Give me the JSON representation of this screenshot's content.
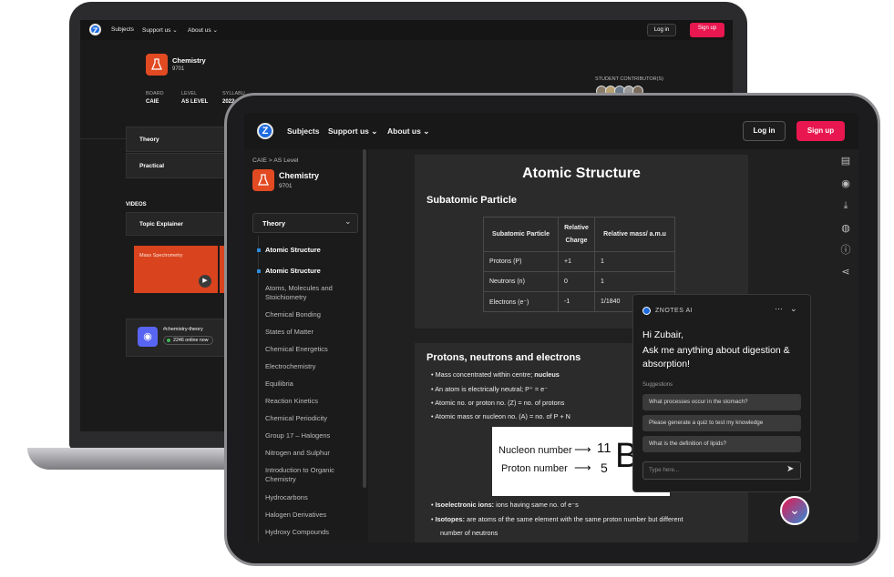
{
  "laptop": {
    "nav": {
      "logo_letter": "Z",
      "links": [
        "Subjects",
        "Support us ⌄",
        "About us ⌄"
      ],
      "login_label": "Log in",
      "signup_label": "Sign up"
    },
    "subject": {
      "name": "Chemistry",
      "code": "9701"
    },
    "meta": {
      "board_label": "BOARD",
      "board_value": "CAIE",
      "level_label": "LEVEL",
      "level_value": "AS LEVEL",
      "syllabus_label": "SYLLABU",
      "syllabus_value": "2022"
    },
    "contributors_label": "STUDENT CONTRIBUTOR(S)",
    "tabs": [
      "Theory",
      "Practical"
    ],
    "videos_label": "VIDEOS",
    "topic_explainer_label": "Topic Explainer",
    "video_title": "Mass Spectrometry",
    "discord": {
      "channel": "#chemistry-theory",
      "online": "2246 online now"
    }
  },
  "tablet": {
    "nav": {
      "logo_letter": "Z",
      "links": [
        "Subjects",
        "Support us ⌄",
        "About us ⌄"
      ],
      "login_label": "Log in",
      "signup_label": "Sign up"
    },
    "breadcrumb": "CAIE  >  AS Level",
    "subject": {
      "name": "Chemistry",
      "code": "9701"
    },
    "dropdown_label": "Theory",
    "sidebar_items": [
      {
        "label": "Atomic Structure",
        "active": true
      },
      {
        "label": "Atomic Structure",
        "active": true
      },
      {
        "label": "Atoms, Molecules and Stoichiometry",
        "active": false
      },
      {
        "label": "Chemical Bonding",
        "active": false
      },
      {
        "label": "States of Matter",
        "active": false
      },
      {
        "label": "Chemical Energetics",
        "active": false
      },
      {
        "label": "Electrochemistry",
        "active": false
      },
      {
        "label": "Equilibria",
        "active": false
      },
      {
        "label": "Reaction Kinetics",
        "active": false
      },
      {
        "label": "Chemical Periodicity",
        "active": false
      },
      {
        "label": "Group 17 – Halogens",
        "active": false
      },
      {
        "label": "Nitrogen and Sulphur",
        "active": false
      },
      {
        "label": "Introduction to Organic Chemistry",
        "active": false
      },
      {
        "label": "Hydrocarbons",
        "active": false
      },
      {
        "label": "Halogen Derivatives",
        "active": false
      },
      {
        "label": "Hydroxy Compounds",
        "active": false
      }
    ],
    "content": {
      "title": "Atomic Structure",
      "section1": "Subatomic Particle",
      "table": {
        "headers": [
          "Subatomic Particle",
          "Relative Charge",
          "Relative mass/ a.m.u"
        ],
        "rows": [
          [
            "Protons (P)",
            "+1",
            "1"
          ],
          [
            "Neutrons (n)",
            "0",
            "1"
          ],
          [
            "Electrons (e⁻)",
            "-1",
            "1/1840"
          ]
        ]
      },
      "section2": "Protons, neutrons and electrons",
      "bullets": [
        {
          "bold": "",
          "pre": "Mass concentrated within centre; ",
          "strong": "nucleus"
        },
        {
          "bold": "",
          "pre": "An atom is electrically neutral; P⁺ = e⁻",
          "strong": ""
        },
        {
          "bold": "",
          "pre": "Atomic no. or proton no. (Z) = no. of protons",
          "strong": ""
        },
        {
          "bold": "",
          "pre": "Atomic mass or nucleon no. (A) = no. of P + N",
          "strong": ""
        }
      ],
      "nuclide": {
        "nucleon_label": "Nucleon number",
        "proton_label": "Proton number",
        "mass_number": "11",
        "atomic_number": "5",
        "symbol": "B"
      },
      "bullets2": [
        {
          "bold": "Isoelectronic ions:",
          "text": " ions having same no. of e⁻s"
        },
        {
          "bold": "Isotopes:",
          "text": " are atoms of the same element with the same proton number but different"
        }
      ],
      "bullets2_cont": "number of neutrons"
    },
    "chat": {
      "brand": "ZNOTES AI",
      "greeting": "Hi Zubair,",
      "prompt": "Ask me anything about digestion & absorption!",
      "suggestions_label": "Suggestions",
      "suggestions": [
        "What processes occur in the stomach?",
        "Please generate a quiz to test my knowledge",
        "What is the definition of lipids?"
      ],
      "input_placeholder": "Type here..."
    }
  },
  "colors": {
    "accent": "#e8174f",
    "brand_blue": "#1e6be0",
    "flask_orange": "#e24a22",
    "discord": "#5865f2"
  }
}
